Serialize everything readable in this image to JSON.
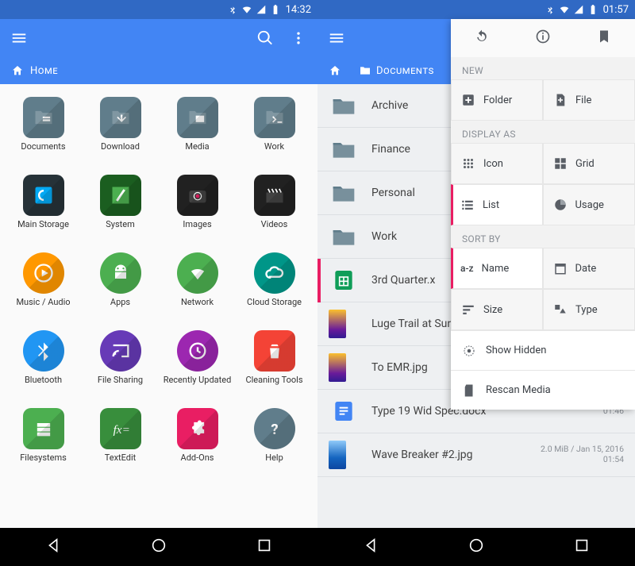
{
  "left": {
    "status_time": "14:32",
    "breadcrumb": "Home",
    "grid": [
      {
        "label": "Documents",
        "color": "#607d8b",
        "icon": "doc"
      },
      {
        "label": "Download",
        "color": "#607d8b",
        "icon": "download"
      },
      {
        "label": "Media",
        "color": "#607d8b",
        "icon": "image"
      },
      {
        "label": "Work",
        "color": "#607d8b",
        "icon": "terminal"
      },
      {
        "label": "Main Storage",
        "color": "#263238",
        "icon": "refresh",
        "round": false
      },
      {
        "label": "System",
        "color": "#1b5e20",
        "icon": "slash",
        "round": false
      },
      {
        "label": "Images",
        "color": "#212121",
        "icon": "camera"
      },
      {
        "label": "Videos",
        "color": "#212121",
        "icon": "clapper"
      },
      {
        "label": "Music / Audio",
        "color": "#ff9800",
        "icon": "play",
        "round": true
      },
      {
        "label": "Apps",
        "color": "#4caf50",
        "icon": "android",
        "round": true
      },
      {
        "label": "Network",
        "color": "#4caf50",
        "icon": "wifi",
        "round": true
      },
      {
        "label": "Cloud Storage",
        "color": "#009688",
        "icon": "cloud",
        "round": true
      },
      {
        "label": "Bluetooth",
        "color": "#2196f3",
        "icon": "bt",
        "round": true
      },
      {
        "label": "File Sharing",
        "color": "#673ab7",
        "icon": "cast",
        "round": true
      },
      {
        "label": "Recently Updated",
        "color": "#9c27b0",
        "icon": "clock",
        "round": true
      },
      {
        "label": "Cleaning Tools",
        "color": "#f44336",
        "icon": "trash"
      },
      {
        "label": "Filesystems",
        "color": "#4caf50",
        "icon": "filesystems"
      },
      {
        "label": "TextEdit",
        "color": "#388e3c",
        "icon": "fx"
      },
      {
        "label": "Add-Ons",
        "color": "#e91e63",
        "icon": "puzzle"
      },
      {
        "label": "Help",
        "color": "#607d8b",
        "icon": "question",
        "round": true
      }
    ]
  },
  "right": {
    "status_time": "01:57",
    "breadcrumb_root": "",
    "breadcrumb_current": "Documents",
    "items": [
      {
        "type": "folder",
        "name": "Archive"
      },
      {
        "type": "folder",
        "name": "Finance"
      },
      {
        "type": "folder",
        "name": "Personal"
      },
      {
        "type": "folder",
        "name": "Work"
      },
      {
        "type": "sheets",
        "name": "3rd Quarter.x"
      },
      {
        "type": "img1",
        "name": "Luge Trail at Sunset.jpg"
      },
      {
        "type": "img1",
        "name": "To EMR.jpg"
      },
      {
        "type": "docx",
        "name": "Type 19 Wid Spec.docx",
        "meta_time": "01:46"
      },
      {
        "type": "img2",
        "name": "Wave Breaker #2.jpg",
        "meta": "2.0 MiB / Jan 15, 2016",
        "meta_time": "01:54"
      }
    ],
    "menu": {
      "section_new": "NEW",
      "new_folder": "Folder",
      "new_file": "File",
      "section_display": "DISPLAY AS",
      "disp_icon": "Icon",
      "disp_grid": "Grid",
      "disp_list": "List",
      "disp_usage": "Usage",
      "section_sort": "SORT BY",
      "sort_name": "Name",
      "sort_date": "Date",
      "sort_size": "Size",
      "sort_type": "Type",
      "show_hidden": "Show Hidden",
      "rescan": "Rescan Media"
    }
  }
}
